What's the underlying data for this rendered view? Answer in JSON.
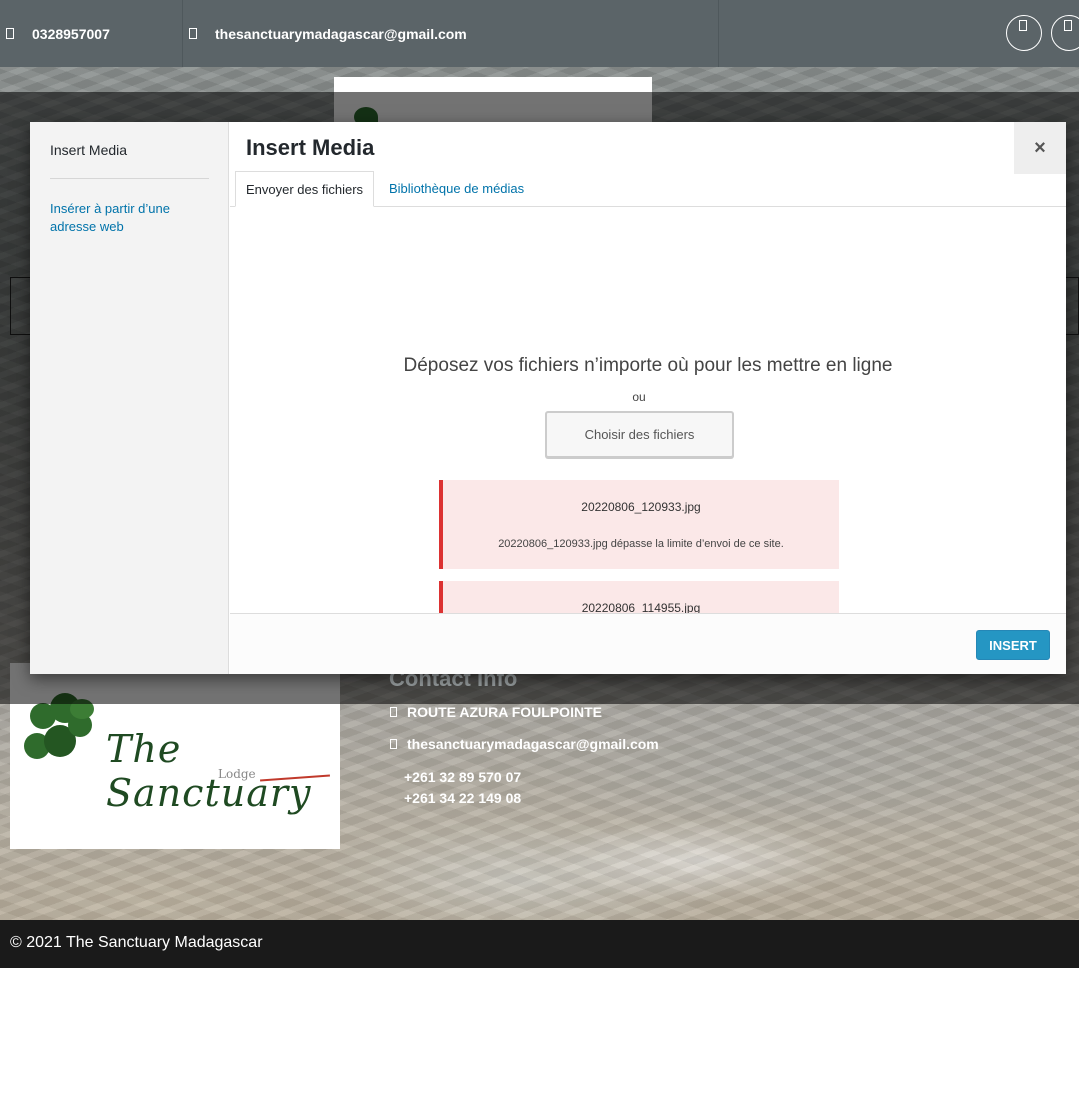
{
  "topbar": {
    "phone": "0328957007",
    "email": "thesanctuarymadagascar@gmail.com"
  },
  "modal": {
    "sidebar_title": "Insert Media",
    "sidebar_link": "Insérer à partir d’une adresse web",
    "title": "Insert Media",
    "close": "×",
    "tabs": [
      {
        "label": "Envoyer des fichiers",
        "active": true
      },
      {
        "label": "Bibliothèque de médias",
        "active": false
      }
    ],
    "drop_title": "Déposez vos fichiers n’importe où pour les mettre en ligne",
    "drop_or": "ou",
    "choose_button": "Choisir des fichiers",
    "errors": [
      {
        "file": "20220806_120933.jpg",
        "message": "20220806_120933.jpg dépasse la limite d’envoi de ce site."
      },
      {
        "file": "20220806_114955.jpg",
        "message": ""
      }
    ],
    "insert_button": "INSERT"
  },
  "contact": {
    "title": "Contact Info",
    "address": "ROUTE AZURA FOULPOINTE",
    "email": "thesanctuarymadagascar@gmail.com",
    "phone1": "+261 32 89 570 07",
    "phone2": "+261 34 22 149 08"
  },
  "logo": {
    "script": "The Sanctuary",
    "sub": "Lodge"
  },
  "footer": {
    "copyright": "© 2021 The Sanctuary Madagascar"
  },
  "colors": {
    "topbar": "#5b6468",
    "link": "#0073aa",
    "insert": "#0085ba",
    "error_border": "#dc3232",
    "error_bg": "#fbe8e8",
    "footer": "#1a1a1a"
  },
  "icons": [
    "phone-icon",
    "mail-icon",
    "social-icon",
    "close-icon",
    "location-icon"
  ]
}
